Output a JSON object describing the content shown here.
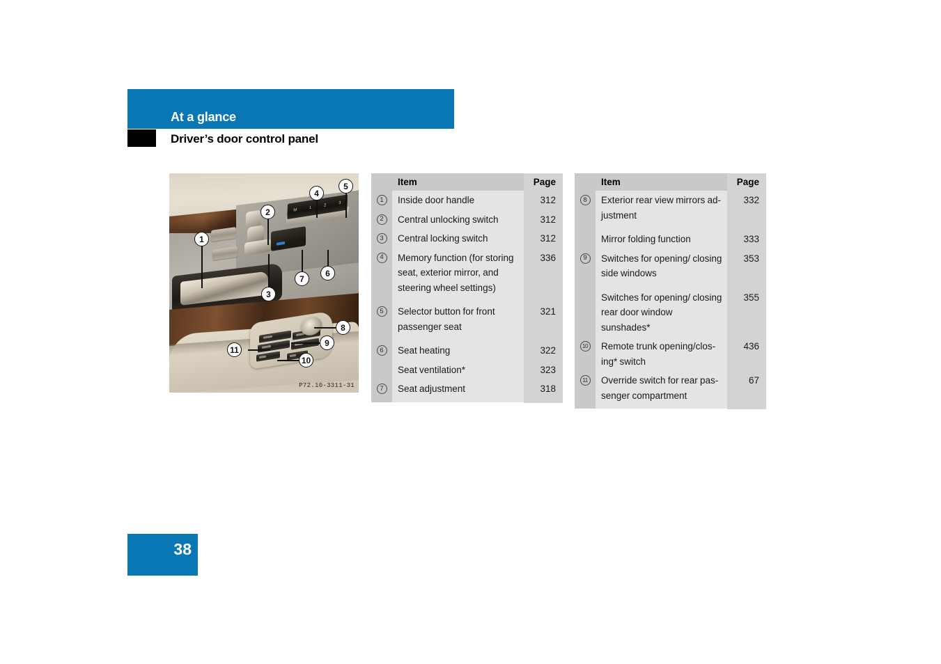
{
  "accent_color": "#0a77b5",
  "header": {
    "title": "At a glance",
    "subtitle": "Driver’s door control panel"
  },
  "figure": {
    "name": "drivers-door-control-panel-photo",
    "code": "P72.10-3311-31",
    "callouts": [
      "1",
      "2",
      "3",
      "4",
      "5",
      "6",
      "7",
      "8",
      "9",
      "10",
      "11"
    ],
    "memory_buttons": [
      "M",
      "1",
      "2",
      "3"
    ]
  },
  "tables": [
    {
      "headers": {
        "item": "Item",
        "page": "Page"
      },
      "rows": [
        {
          "num": "1",
          "item": "Inside door handle",
          "page": "312"
        },
        {
          "num": "2",
          "item": "Central unlocking switch",
          "page": "312"
        },
        {
          "num": "3",
          "item": "Central locking switch",
          "page": "312"
        },
        {
          "num": "4",
          "item": "Memory function (for storing seat, exterior mirror, and steering wheel settings)",
          "page": "336"
        },
        {
          "num": "5",
          "item": "Selector button for front passenger seat",
          "page": "321"
        },
        {
          "num": "6",
          "item": "Seat heating",
          "page": "322"
        },
        {
          "num": "",
          "item": "Seat ventilation*",
          "page": "323"
        },
        {
          "num": "7",
          "item": "Seat adjustment",
          "page": "318"
        }
      ]
    },
    {
      "headers": {
        "item": "Item",
        "page": "Page"
      },
      "rows": [
        {
          "num": "8",
          "item": "Exterior rear view mirrors ad-justment",
          "page": "332"
        },
        {
          "num": "",
          "item": "Mirror folding function",
          "page": "333"
        },
        {
          "num": "9",
          "item": "Switches for opening/ closing side windows",
          "page": "353"
        },
        {
          "num": "",
          "item": "Switches for opening/ closing rear door window sunshades*",
          "page": "355"
        },
        {
          "num": "10",
          "item": "Remote trunk opening/clos-ing* switch",
          "page": "436"
        },
        {
          "num": "11",
          "item": "Override switch for rear pas-senger compartment",
          "page": "67"
        }
      ]
    }
  ],
  "footer": {
    "page_number": "38"
  }
}
